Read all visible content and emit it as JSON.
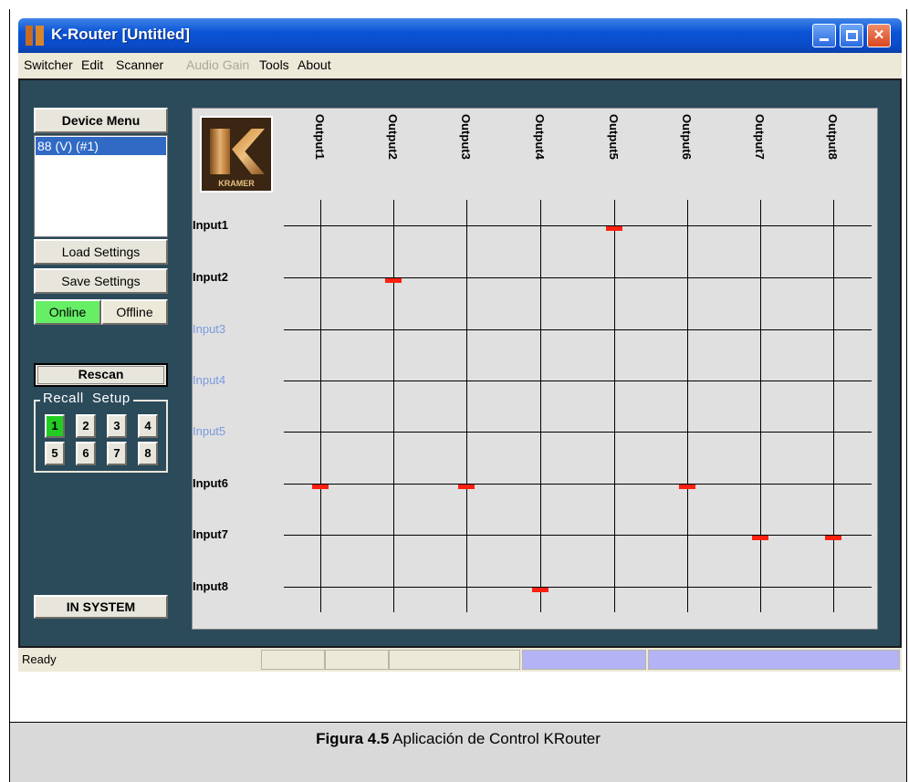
{
  "window": {
    "title": "K-Router [Untitled]"
  },
  "menu": {
    "items": [
      "Switcher",
      "Edit",
      "Scanner",
      "Audio Gain",
      "Tools",
      "About"
    ]
  },
  "sidebar": {
    "device_menu_title": "Device Menu",
    "devices": [
      "88 (V) (#1)"
    ],
    "load_settings": "Load Settings",
    "save_settings": "Save Settings",
    "online": "Online",
    "offline": "Offline",
    "rescan": "Rescan",
    "recall_setup_label": "Recall  Setup",
    "recall_buttons": [
      "1",
      "2",
      "3",
      "4",
      "5",
      "6",
      "7",
      "8"
    ],
    "recall_active": "1",
    "system_button": "IN SYSTEM"
  },
  "matrix": {
    "logo_text": "KRAMER",
    "outputs": [
      "Output1",
      "Output2",
      "Output3",
      "Output4",
      "Output5",
      "Output6",
      "Output7",
      "Output8"
    ],
    "inputs": [
      "Input1",
      "Input2",
      "Input3",
      "Input4",
      "Input5",
      "Input6",
      "Input7",
      "Input8"
    ],
    "inactive_inputs": [
      "Input3",
      "Input4",
      "Input5"
    ],
    "routes": {
      "Output1": "Input6",
      "Output2": "Input2",
      "Output3": "Input6",
      "Output4": "Input8",
      "Output5": "Input1",
      "Output6": "Input6",
      "Output7": "Input7",
      "Output8": "Input7"
    },
    "route_color": "#ff2010"
  },
  "status": {
    "text": "Ready"
  },
  "caption": {
    "figure": "Figura 4.5",
    "text": " Aplicación de Control KRouter"
  }
}
